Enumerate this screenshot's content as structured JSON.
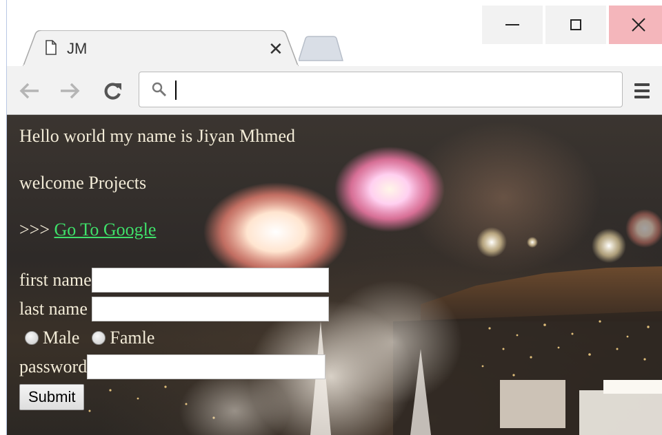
{
  "window": {
    "minimize_icon": "minimize-icon",
    "maximize_icon": "maximize-icon",
    "close_icon": "close-icon",
    "colors": {
      "close_hover": "#f4b6bb"
    }
  },
  "tab": {
    "title": "JM",
    "icon": "document-icon",
    "close_glyph": "✕"
  },
  "toolbar": {
    "back_icon": "back-arrow-icon",
    "forward_icon": "forward-arrow-icon",
    "reload_icon": "reload-icon",
    "search_icon": "search-icon",
    "omnibox_value": "",
    "menu_icon": "menu-icon"
  },
  "page": {
    "greeting": "Hello world my name is Jiyan Mhmed",
    "welcome": "welcome Projects",
    "link_prefix": ">>> ",
    "link_text": "Go To Google",
    "link_color": "#3fe06a",
    "form": {
      "first_name_label": "first name",
      "first_name_value": "",
      "last_name_label": "last name",
      "last_name_value": "",
      "gender_options": [
        "Male",
        "Famle"
      ],
      "password_label": "password",
      "password_value": "",
      "submit_label": "Submit"
    }
  }
}
